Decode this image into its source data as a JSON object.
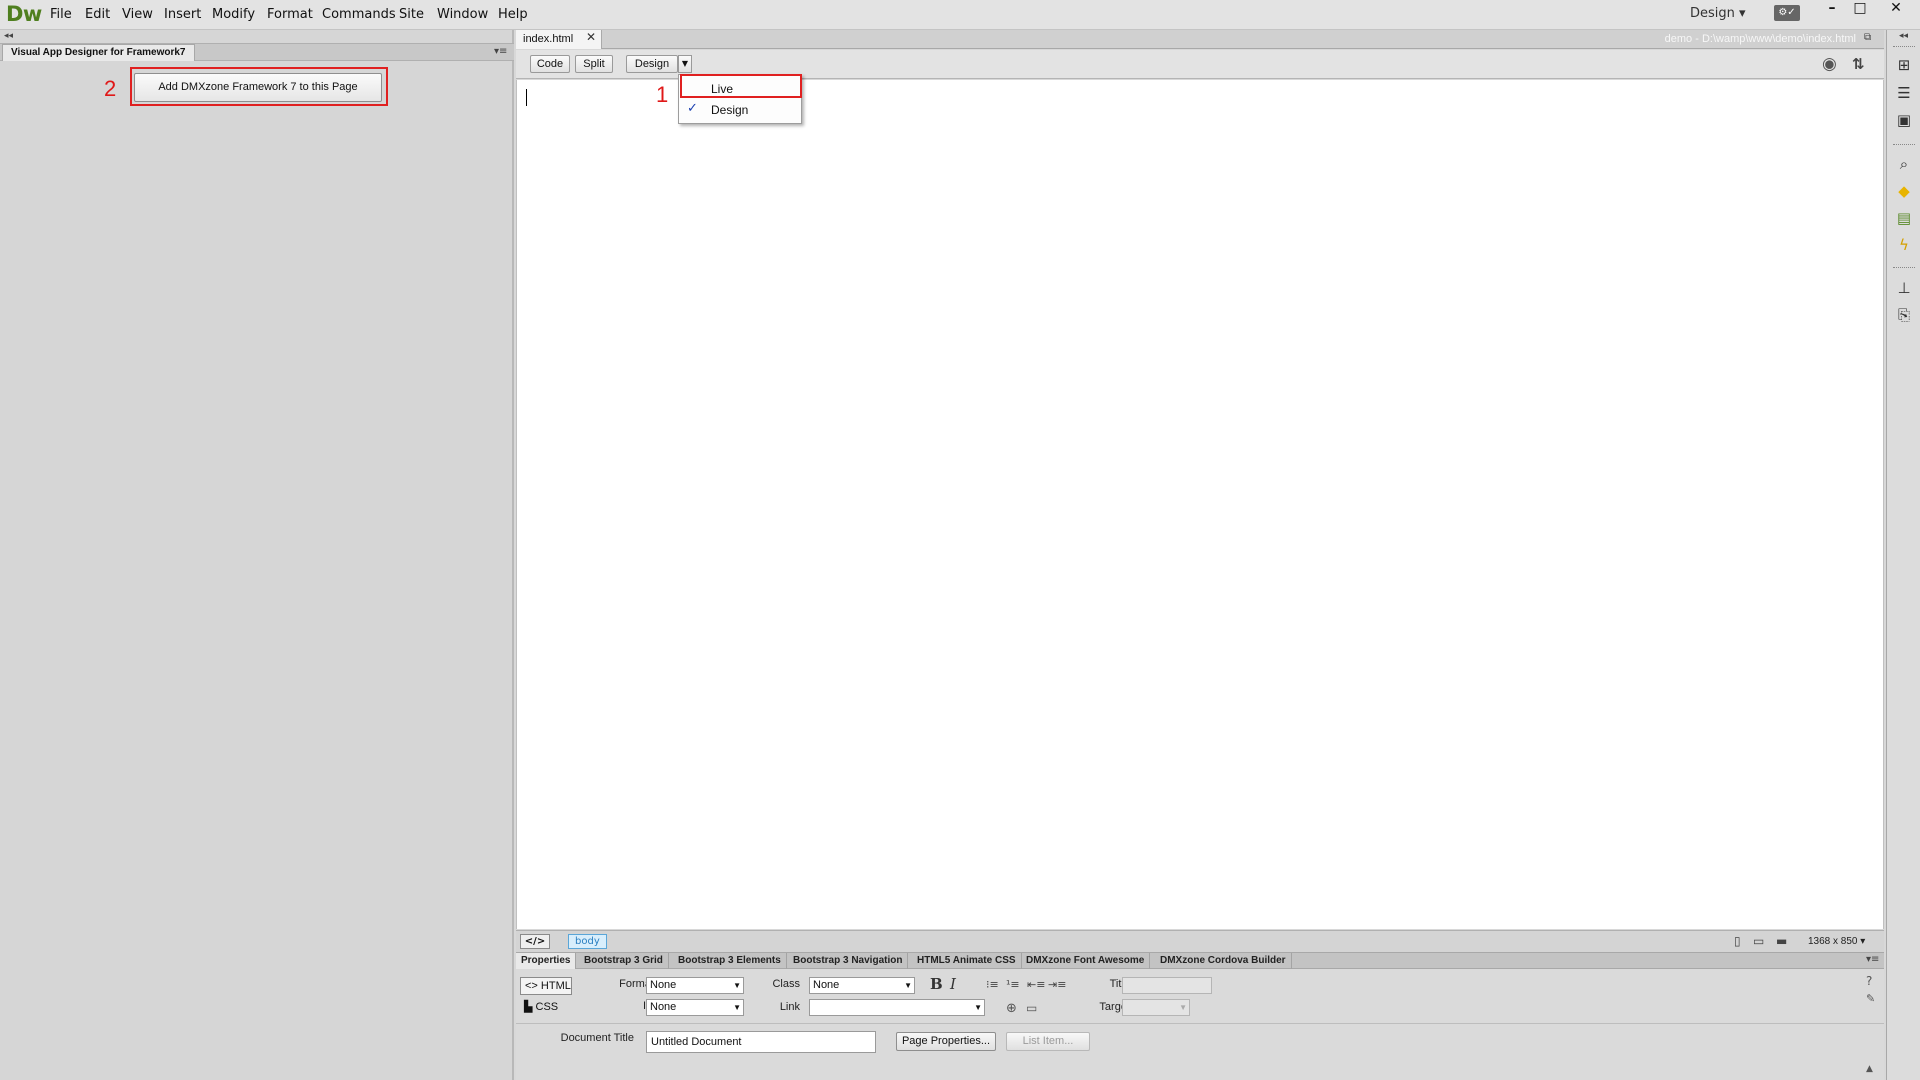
{
  "app": {
    "logo": "Dw",
    "menu": [
      "File",
      "Edit",
      "View",
      "Insert",
      "Modify",
      "Format",
      "Commands",
      "Site",
      "Window",
      "Help"
    ],
    "workspace": "Design ▾",
    "window_controls": {
      "minimize": "–",
      "maximize": "□",
      "close": "✕"
    }
  },
  "left_panel": {
    "tab_label": "Visual App Designer for Framework7",
    "add_button_label": "Add DMXzone Framework 7 to this Page",
    "callout_number": "2"
  },
  "document": {
    "tab_label": "index.html",
    "path": "demo - D:\\wamp\\www\\demo\\index.html",
    "view_buttons": {
      "code": "Code",
      "split": "Split",
      "design": "Design"
    },
    "view_menu": {
      "items": [
        {
          "label": "Live",
          "checked": false
        },
        {
          "label": "Design",
          "checked": true
        }
      ],
      "callout_number": "1"
    }
  },
  "status_bar": {
    "tag_selector": "body",
    "window_size": "1368 x 850 ▾"
  },
  "properties": {
    "tabs": [
      "Properties",
      "Bootstrap 3 Grid",
      "Bootstrap 3 Elements",
      "Bootstrap 3 Navigation",
      "HTML5 Animate CSS",
      "DMXzone Font Awesome",
      "DMXzone Cordova Builder"
    ],
    "mode_html": "HTML",
    "mode_css": "CSS",
    "format_label": "Format",
    "format_value": "None",
    "id_label": "ID",
    "id_value": "None",
    "class_label": "Class",
    "class_value": "None",
    "link_label": "Link",
    "link_value": "",
    "bold_label": "B",
    "italic_label": "I",
    "title_label": "Title",
    "target_label": "Target",
    "doc_title_label": "Document Title",
    "doc_title_value": "Untitled Document",
    "page_props_button": "Page Properties...",
    "list_item_button": "List Item..."
  },
  "colors": {
    "accent_red": "#e02020",
    "dw_green": "#4f7f1f",
    "tag_blue": "#2a7fc0"
  }
}
